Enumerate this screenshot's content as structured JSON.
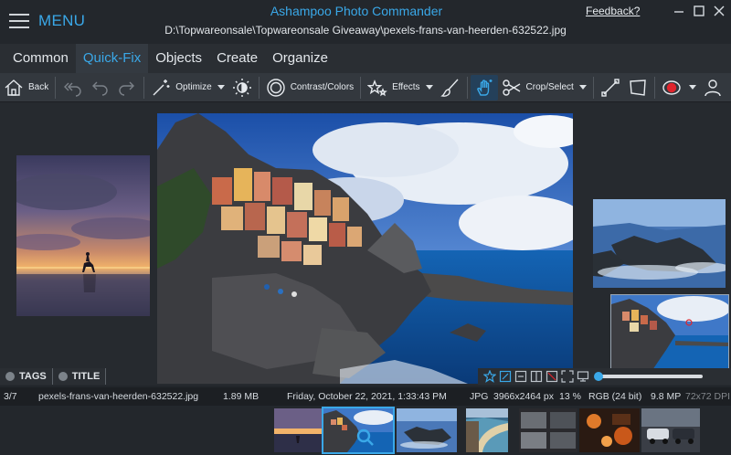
{
  "window": {
    "menu_label": "MENU",
    "app_title": "Ashampoo Photo Commander",
    "file_path": "D:\\Topwareonsale\\Topwareonsale Giveaway\\pexels-frans-van-heerden-632522.jpg",
    "feedback_link": "Feedback?"
  },
  "tabs": [
    {
      "label": "Common"
    },
    {
      "label": "Quick-Fix",
      "active": true
    },
    {
      "label": "Objects"
    },
    {
      "label": "Create"
    },
    {
      "label": "Organize"
    }
  ],
  "toolbar": {
    "back_label": "Back",
    "optimize_label": "Optimize",
    "contrast_label": "Contrast/Colors",
    "effects_label": "Effects",
    "crop_label": "Crop/Select"
  },
  "tag_panel": {
    "tags_label": "TAGS",
    "title_label": "TITLE"
  },
  "view_controls": {
    "zoom_slider_fraction": 0.0
  },
  "status": {
    "position": "3/7",
    "filename": "pexels-frans-van-heerden-632522.jpg",
    "filesize": "1.89 MB",
    "date": "Friday, October 22, 2021, 1:33:43 PM",
    "format": "JPG",
    "dimensions": "3966x2464 px",
    "zoom": "13 %",
    "color_mode": "RGB (24 bit)",
    "megapixels": "9.8 MP",
    "dpi": "72x72 DPI"
  },
  "colors": {
    "accent": "#3aa8e8",
    "background": "#22262b",
    "record": "#e0242c"
  }
}
